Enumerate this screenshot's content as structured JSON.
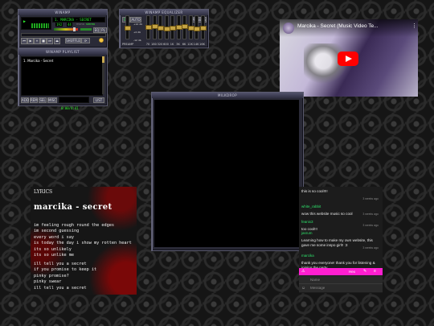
{
  "winamp": {
    "title": "WINAMP",
    "track_scroller": "1. MARCIKA - SECRET",
    "kbps": "192",
    "khz": "44",
    "mono": "mono",
    "stereo": "stereo",
    "eq_label": "EQ",
    "pl_label": "PL",
    "shuffle_label": "SHUFFLE",
    "volume_level": 0.8,
    "balance_level": 0.5,
    "seek_level": 0.0
  },
  "equalizer": {
    "title": "WINAMP EQUALIZER",
    "on_label": "ON",
    "auto_label": "AUTO",
    "presets_label": "PRESETS",
    "db_top": "+12 db",
    "db_mid": "+0 db",
    "db_bot": "-12 db",
    "preamp_label": "PREAMP",
    "bands": [
      "70",
      "180",
      "320",
      "600",
      "1K",
      "3K",
      "6K",
      "12K",
      "14K",
      "16K"
    ],
    "band_levels": [
      0.55,
      0.6,
      0.5,
      0.45,
      0.5,
      0.55,
      0.6,
      0.5,
      0.45,
      0.5
    ],
    "preamp_level": 0.5
  },
  "playlist": {
    "title": "WINAMP PLAYLIST",
    "items": [
      "1. Marcika - Secret"
    ],
    "time_readout": "0:00/4:41",
    "add_label": "ADD",
    "rem_label": "REM",
    "sel_label": "SEL",
    "misc_label": "MISC",
    "list_label": "LIST"
  },
  "youtube": {
    "title": "Marcika - Secret (Music Video Te...",
    "colors": {
      "play": "#ff0000"
    }
  },
  "webamp_box": {
    "title": "MILKDROP"
  },
  "lyrics": {
    "label": "LYRICS",
    "song_title": "marcika - secret",
    "stanza1": [
      "im feeling rough round the edges",
      "im second guessing",
      "every word i say",
      "is today the day i show my rotten heart",
      "its so unlikely",
      "its so unlike me"
    ],
    "stanza2": [
      "ill tell you a secret",
      "if you promise to keep it",
      "pinky promise?",
      "pinky swear",
      "ill tell you a secret"
    ]
  },
  "chat": {
    "messages": [
      {
        "name": "",
        "time": "",
        "text": "this is so cool!!!!"
      },
      {
        "name": "white_rabbit",
        "time": "3 weeks ago",
        "text": "wow this website music so cool"
      },
      {
        "name": "feanix3",
        "time": "3 weeks ago",
        "text": "too cool!!!"
      },
      {
        "name": "jasrum",
        "time": "3 weeks ago",
        "text": "Learning how to make my own website, this gave me some inspo girl!! :3"
      },
      {
        "name": "marcika",
        "time": "3 weeks ago",
        "text": "thank you everyone! thank you for listening & joining the party"
      }
    ],
    "toolbar": {
      "online": "Hex",
      "count": "1"
    },
    "name_placeholder": "Name",
    "message_placeholder": "Message",
    "colors": {
      "accent": "#ff1fd0",
      "name": "#2ee06a"
    }
  }
}
